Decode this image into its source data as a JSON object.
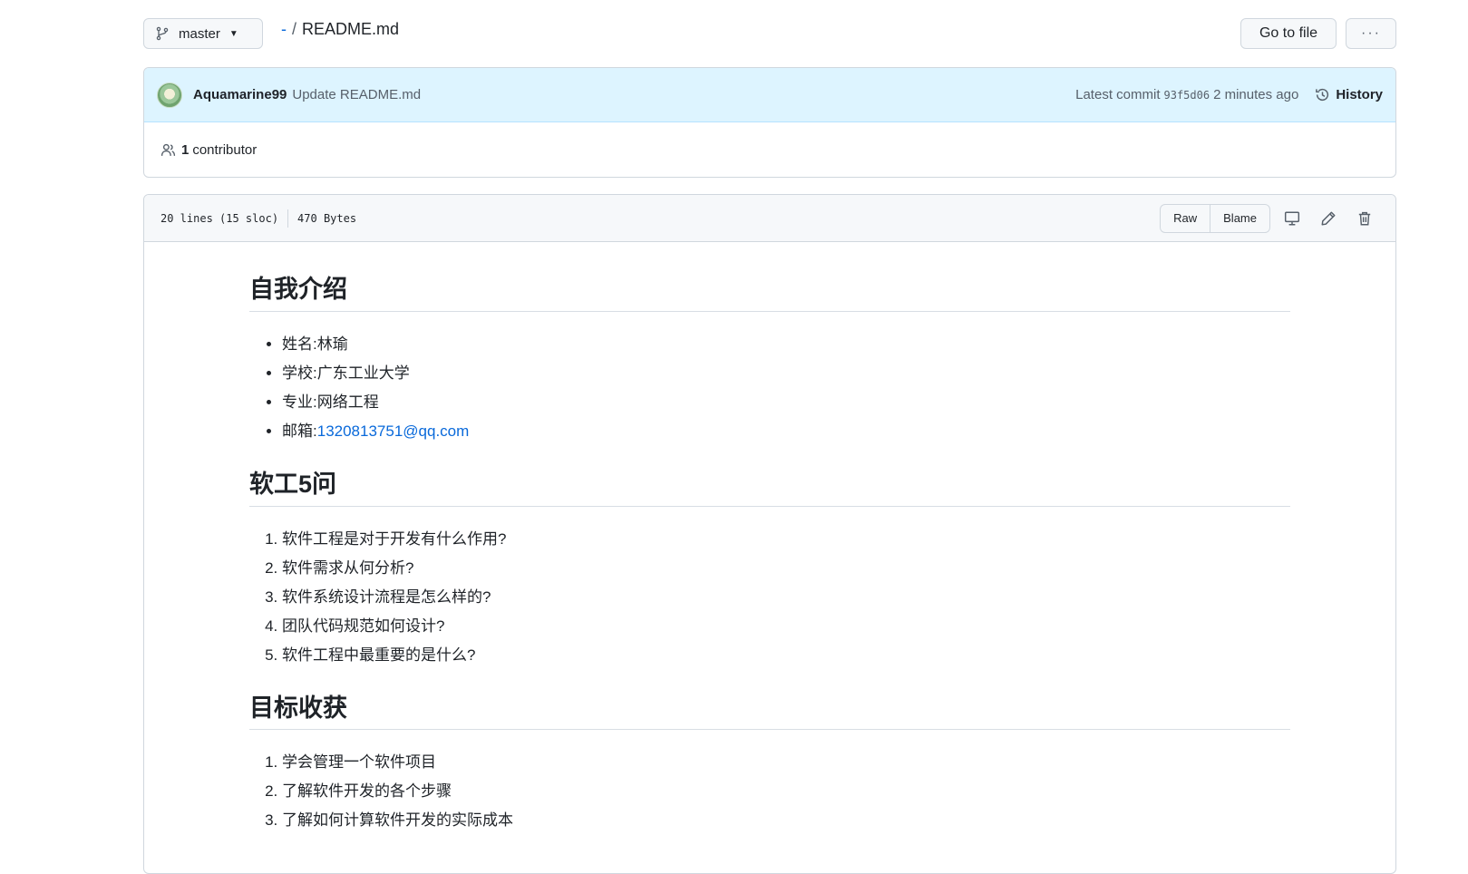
{
  "topbar": {
    "branch": "master",
    "breadcrumb_root": "-",
    "breadcrumb_sep": "/",
    "file_name": "README.md",
    "goto_label": "Go to file",
    "more_label": "···"
  },
  "commit": {
    "author": "Aquamarine99",
    "message": "Update README.md",
    "latest_label": "Latest commit",
    "sha": "93f5d06",
    "time": "2 minutes ago",
    "history_label": "History"
  },
  "contributors": {
    "count": "1",
    "label": "contributor"
  },
  "file": {
    "lines": "20 lines (15 sloc)",
    "size": "470 Bytes",
    "raw_label": "Raw",
    "blame_label": "Blame"
  },
  "readme": {
    "section1": {
      "title": "自我介绍",
      "items": [
        "姓名:林瑜",
        "学校:广东工业大学",
        "专业:网络工程"
      ],
      "email_prefix": "邮箱:",
      "email": "1320813751@qq.com"
    },
    "section2": {
      "title": "软工5问",
      "items": [
        "软件工程是对于开发有什么作用?",
        "软件需求从何分析?",
        "软件系统设计流程是怎么样的?",
        "团队代码规范如何设计?",
        "软件工程中最重要的是什么?"
      ]
    },
    "section3": {
      "title": "目标收获",
      "items": [
        "学会管理一个软件项目",
        "了解软件开发的各个步骤",
        "了解如何计算软件开发的实际成本"
      ]
    }
  },
  "colors": {
    "link": "#0969da",
    "commit_bg": "#ddf4ff",
    "border": "#d0d7de"
  }
}
